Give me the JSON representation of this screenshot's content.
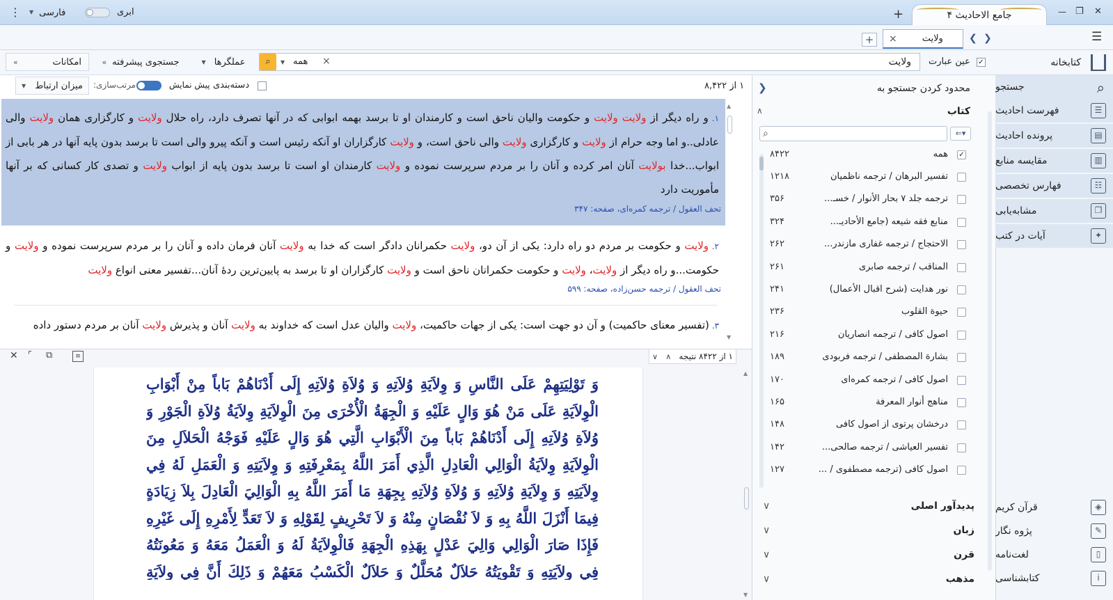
{
  "titlebar": {
    "app_title": "جامع الاحادیث ۴",
    "theme_label": "ابری",
    "language": "فارسی",
    "menu_glyph": "⋮",
    "new_tab": "+",
    "minimize": "—",
    "restore": "❐",
    "close": "✕"
  },
  "tabbar": {
    "tab_label": "ولایت",
    "tab_close": "×",
    "add_tab": "+",
    "back": "❮",
    "forward": "❯",
    "menu": "☰"
  },
  "search": {
    "query": "ولایت",
    "exact_phrase_label": "عین عبارت",
    "exact_checked": true,
    "clear": "×",
    "scope": "همه",
    "operators_label": "عملگرها",
    "advanced_label": "جستجوی پیشرفته",
    "features_label": "امکانات"
  },
  "nav": {
    "library_label": "کتابخانه",
    "search_label": "جستجو",
    "items": [
      {
        "label": "فهرست احادیث",
        "icon": "list-icon"
      },
      {
        "label": "پرونده احادیث",
        "icon": "file-icon"
      },
      {
        "label": "مقایسه منابع",
        "icon": "compare-icon"
      },
      {
        "label": "فهارس تخصصی",
        "icon": "index-icon"
      },
      {
        "label": "مشابه‌یابی",
        "icon": "similar-icon"
      },
      {
        "label": "آیات در کتب",
        "icon": "verses-icon"
      }
    ],
    "bottom_items": [
      {
        "label": "قرآن کریم",
        "icon": "quran-icon"
      },
      {
        "label": "پژوه نگار",
        "icon": "note-icon"
      },
      {
        "label": "لغت‌نامه",
        "icon": "dictionary-icon"
      },
      {
        "label": "کتابشناسی",
        "icon": "info-icon"
      }
    ]
  },
  "filter": {
    "title": "محدود کردن جستجو به",
    "books_label": "کتاب",
    "search_placeholder": "",
    "all_label": "همه",
    "all_count": "۸۴۲۲",
    "books": [
      {
        "name": "تفسیر البرهان / ترجمه ناظمیان",
        "count": "۱۲۱۸"
      },
      {
        "name": "ترجمه جلد ۷ بحار الأنوار / خسـ...",
        "count": "۳۵۶"
      },
      {
        "name": "منابع فقه شیعه (جامع الأحادیـ...",
        "count": "۳۲۴"
      },
      {
        "name": "الاحتجاج / ترجمه غفاری مازندر...",
        "count": "۲۶۲"
      },
      {
        "name": "المناقب / ترجمه صابری",
        "count": "۲۶۱"
      },
      {
        "name": "نور هدایت (شرح اقبال الأعمال)",
        "count": "۲۴۱"
      },
      {
        "name": "حیوة القلوب",
        "count": "۲۳۶"
      },
      {
        "name": "اصول کافی / ترجمه انصاریان",
        "count": "۲۱۶"
      },
      {
        "name": "بشارة المصطفی / ترجمه فربودی",
        "count": "۱۸۹"
      },
      {
        "name": "اصول کافی / ترجمه کمره‌ای",
        "count": "۱۷۰"
      },
      {
        "name": "مناهج أنوار المعرفة",
        "count": "۱۶۵"
      },
      {
        "name": "درخشان پرتوی از اصول کافی",
        "count": "۱۴۸"
      },
      {
        "name": "تفسیر العیاشی / ترجمه صالحی...",
        "count": "۱۴۲"
      },
      {
        "name": "اصول کافی (ترجمه مصطفوی / ...",
        "count": "۱۲۷"
      }
    ],
    "sections": [
      "پدیدآور اصلی",
      "زبان",
      "قرن",
      "مذهب"
    ]
  },
  "results": {
    "count_label": "۱ از ۸,۴۲۲",
    "sort_label": "میزان ارتباط",
    "sort_prefix": "مرتب‌سازی:",
    "preview_label": "پیش نمایش",
    "grouping_label": "دسته‌بندی",
    "r1_source": "تحف العقول / ترجمه کمره‌ای، صفحه: ۳۴۷",
    "r2_source": "تحف العقول / ترجمه حسن‌زاده، صفحه: ۵۹۹"
  },
  "detail": {
    "result_nav": "۱ از ۸۴۲۲ نتیجه",
    "arabic_text": "وَ تَوْلِيَتِهِمْ عَلَى النَّاسِ وَ وِلاَيَةِ وُلاَتِهِ وَ وُلاَةِ وُلاَتِهِ إِلَى أَدْنَاهُمْ بَاباً مِنْ أَبْوَابِ الْوِلاَيَةِ عَلَى مَنْ هُوَ وَالٍ عَلَيْهِ وَ الْجِهَةُ الْأُخْرَى مِنَ الْوِلاَيَةِ وِلاَيَةُ وُلاَةِ الْجَوْرِ وَ وُلاَةِ وُلاَتِهِ إِلَى أَدْنَاهُمْ بَاباً مِنَ الْأَبْوَابِ الَّتِي هُوَ وَالٍ عَلَيْهِ فَوَجْهُ الْحَلاَلِ مِنَ الْوِلاَيَةِ وِلاَيَةُ الْوَالِي الْعَادِلِ الَّذِي أَمَرَ اللَّهُ بِمَعْرِفَتِهِ وَ وِلاَيَتِهِ وَ الْعَمَلِ لَهُ فِي وِلاَيَتِهِ وَ وِلاَيَةِ وُلاَتِهِ وَ وُلاَةِ وُلاَتِهِ بِجِهَةِ مَا أَمَرَ اللَّهُ بِهِ الْوَالِيَ الْعَادِلَ بِلاَ زِيَادَةٍ فِيمَا أَنْزَلَ اللَّهُ بِهِ وَ لاَ نُقْصَانٍ مِنْهُ وَ لاَ تَحْرِيفٍ لِقَوْلِهِ وَ لاَ تَعَدٍّ لِأَمْرِهِ إِلَى غَيْرِهِ فَإِذَا صَارَ الْوَالِي وَالِيَ عَدْلٍ بِهَذِهِ الْجِهَةِ فَالْوِلاَيَةُ لَهُ وَ الْعَمَلُ مَعَهُ وَ مَعُونَتُهُ فِي وِلاَيَتِهِ وَ تَقْوِيَتُهُ حَلاَلٌ مُحَلَّلٌ وَ حَلاَلٌ الْكَسْبُ مَعَهُمْ وَ ذَلِكَ أَنَّ فِي وِلاَيَةِ وَالِي الْعَدْلِ وَ وُلاَتِهِ إِحْيَاءَ كُلِّ حَقٍّ وَ كُلِّ عَدْلٍ وَ إِمَاتَةَ كُلِّ ظُلْمٍ وَ جَوْرٍ وَ فَسَادٍ فَلِذَلِكَ كَانَ السَّاعِي فِي تَقْوِيَةِ سُلْطَانِهِ وَ الْمُعِينُ لَهُ عَلَى"
  }
}
